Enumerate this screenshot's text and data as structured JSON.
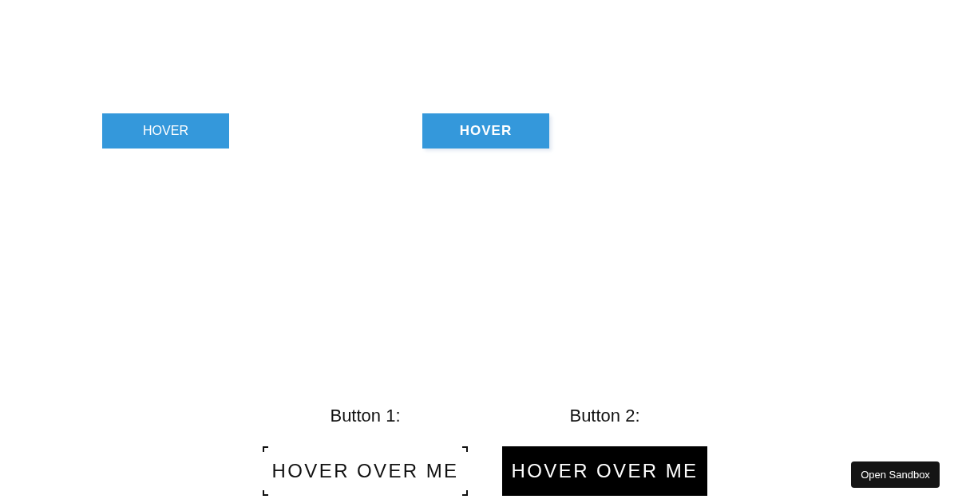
{
  "hover_buttons": [
    {
      "label": "HOVER",
      "kind": "plain"
    },
    {
      "label": "HOVER",
      "kind": "bold"
    }
  ],
  "demo_buttons": [
    {
      "caption": "Button 1:",
      "label": "HOVER OVER ME",
      "kind": "corners"
    },
    {
      "caption": "Button 2:",
      "label": "HOVER OVER ME",
      "kind": "filled"
    }
  ],
  "sandbox_button": {
    "label": "Open Sandbox"
  }
}
